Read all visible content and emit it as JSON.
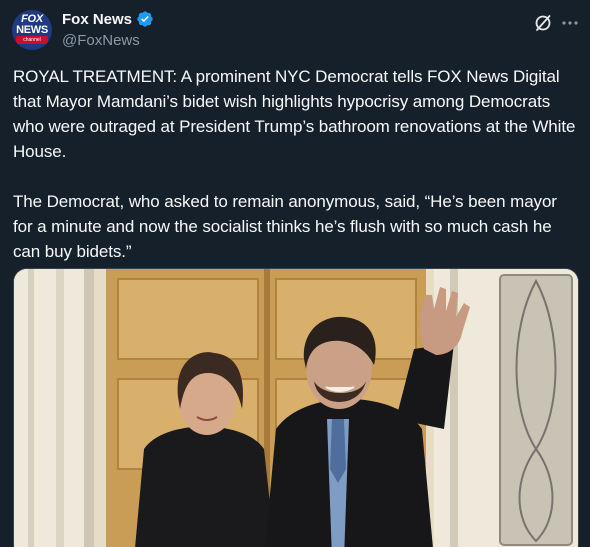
{
  "author": {
    "display_name": "Fox News",
    "handle": "@FoxNews",
    "avatar": {
      "line1": "FOX",
      "line2": "NEWS",
      "line3": "channel"
    }
  },
  "icons": {
    "verified": "verified-badge-icon",
    "grok": "grok-icon",
    "more": "more-options-icon"
  },
  "colors": {
    "background": "#15202b",
    "text": "#f7f9f9",
    "secondary_text": "#8b98a5",
    "verified": "#1d9bf0"
  },
  "tweet": {
    "paragraph1": "ROYAL TREATMENT: A prominent NYC Democrat tells FOX News Digital that Mayor Mamdani’s bidet wish highlights hypocrisy among Democrats who were outraged at President Trump’s bathroom renovations at the White House.",
    "paragraph2": "The Democrat, who asked to remain anonymous, said, “He’s been mayor for a minute and now the socialist thinks he’s flush with so much cash he can buy bidets.”"
  }
}
